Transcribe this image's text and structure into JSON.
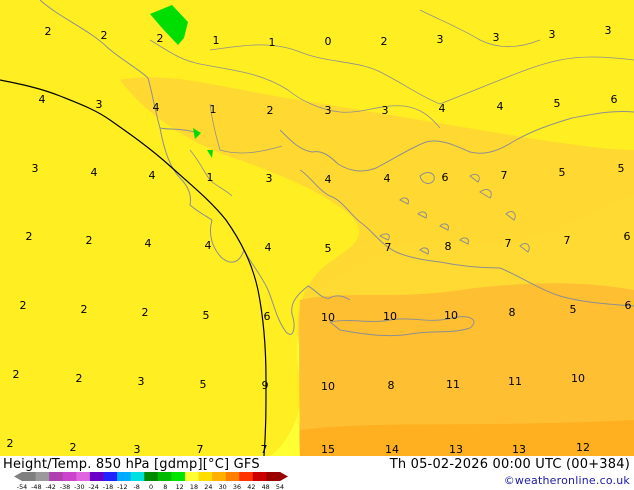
{
  "footer": {
    "title": "Height/Temp. 850 hPa [gdmp][°C] GFS",
    "timestamp": "Th 05-02-2026 00:00 UTC (00+384)",
    "credit": "©weatheronline.co.uk"
  },
  "legend": {
    "ticks": [
      "-54",
      "-48",
      "-42",
      "-38",
      "-30",
      "-24",
      "-18",
      "-12",
      "-8",
      "0",
      "8",
      "12",
      "18",
      "24",
      "30",
      "36",
      "42",
      "48",
      "54"
    ],
    "colors": [
      "#7f7f7f",
      "#9a9a9a",
      "#b040b0",
      "#cc44cc",
      "#e066e0",
      "#6a00c8",
      "#2222ff",
      "#00aaff",
      "#00e0e0",
      "#008a00",
      "#00bb00",
      "#00e600",
      "#ffff33",
      "#ffdd00",
      "#ffb000",
      "#ff7f00",
      "#ff3300",
      "#cc0000",
      "#990000"
    ]
  },
  "map": {
    "colors": {
      "pale_yellow": "#ffff33",
      "yellow": "#ffee22",
      "gold": "#ffd633",
      "orange": "#ffbf33",
      "deep_orange": "#ffb020",
      "green": "#00dd00",
      "coast": "#8e8e8e",
      "border": "#8e8e8e"
    },
    "temperatures": [
      "2",
      "2",
      "2",
      "1",
      "1",
      "0",
      "2",
      "3",
      "3",
      "3",
      "3",
      "4",
      "3",
      "4",
      "1",
      "2",
      "3",
      "3",
      "4",
      "4",
      "5",
      "6",
      "3",
      "4",
      "4",
      "1",
      "3",
      "4",
      "4",
      "6",
      "7",
      "5",
      "5",
      "2",
      "2",
      "4",
      "4",
      "4",
      "5",
      "7",
      "8",
      "7",
      "7",
      "6",
      "2",
      "2",
      "2",
      "5",
      "6",
      "10",
      "10",
      "10",
      "8",
      "5",
      "6",
      "2",
      "2",
      "3",
      "5",
      "9",
      "10",
      "8",
      "11",
      "11",
      "10",
      "2",
      "2",
      "3",
      "7",
      "7",
      "15",
      "14",
      "13",
      "13",
      "12"
    ]
  }
}
